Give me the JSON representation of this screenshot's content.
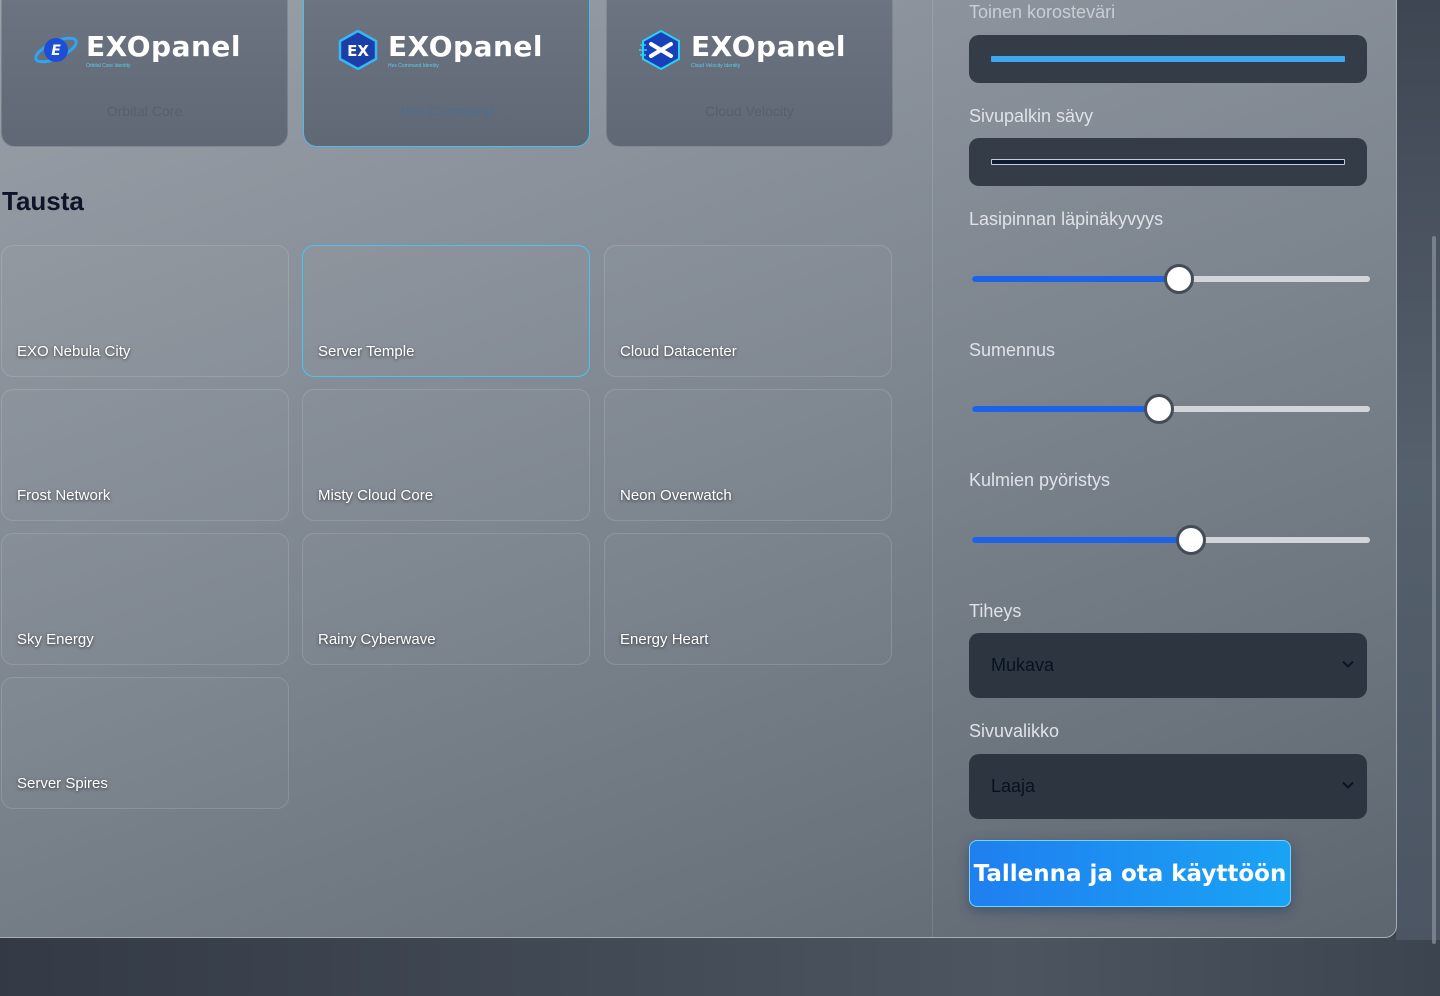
{
  "logos": [
    {
      "name": "EXOpanel",
      "subtitle": "Orbital Core Identity",
      "caption": "Orbital Core",
      "selected": false
    },
    {
      "name": "EXOpanel",
      "subtitle": "Hex Command Identity",
      "caption": "Hex Command",
      "selected": true
    },
    {
      "name": "EXOpanel",
      "subtitle": "Cloud Velocity Identity",
      "caption": "Cloud Velocity",
      "selected": false
    }
  ],
  "background_section": {
    "title": "Tausta",
    "tiles": [
      {
        "label": "EXO Nebula City",
        "selected": false
      },
      {
        "label": "Server Temple",
        "selected": true
      },
      {
        "label": "Cloud Datacenter",
        "selected": false
      },
      {
        "label": "Frost Network",
        "selected": false
      },
      {
        "label": "Misty Cloud Core",
        "selected": false
      },
      {
        "label": "Neon Overwatch",
        "selected": false
      },
      {
        "label": "Sky Energy",
        "selected": false
      },
      {
        "label": "Rainy Cyberwave",
        "selected": false
      },
      {
        "label": "Energy Heart",
        "selected": false
      },
      {
        "label": "Server Spires",
        "selected": false
      }
    ]
  },
  "settings": {
    "secondary_accent": {
      "label": "Toinen korosteväri",
      "color": "#3da8f0"
    },
    "sidebar_tone": {
      "label": "Sivupalkin sävy",
      "color": "#101a33"
    },
    "glass_opacity": {
      "label": "Lasipinnan läpinäkyvyys",
      "value_percent": 52
    },
    "blur": {
      "label": "Sumennus",
      "value_percent": 47
    },
    "corner_radius": {
      "label": "Kulmien pyöristys",
      "value_percent": 55
    },
    "density": {
      "label": "Tiheys",
      "value": "Mukava"
    },
    "sidebar_menu": {
      "label": "Sivuvalikko",
      "value": "Laaja"
    },
    "save_label": "Tallenna ja ota käyttöön"
  },
  "colors": {
    "accent": "#1d63e8",
    "selection": "#46c6ef",
    "button_start": "#1f7ff0",
    "button_end": "#1aa3f4"
  }
}
